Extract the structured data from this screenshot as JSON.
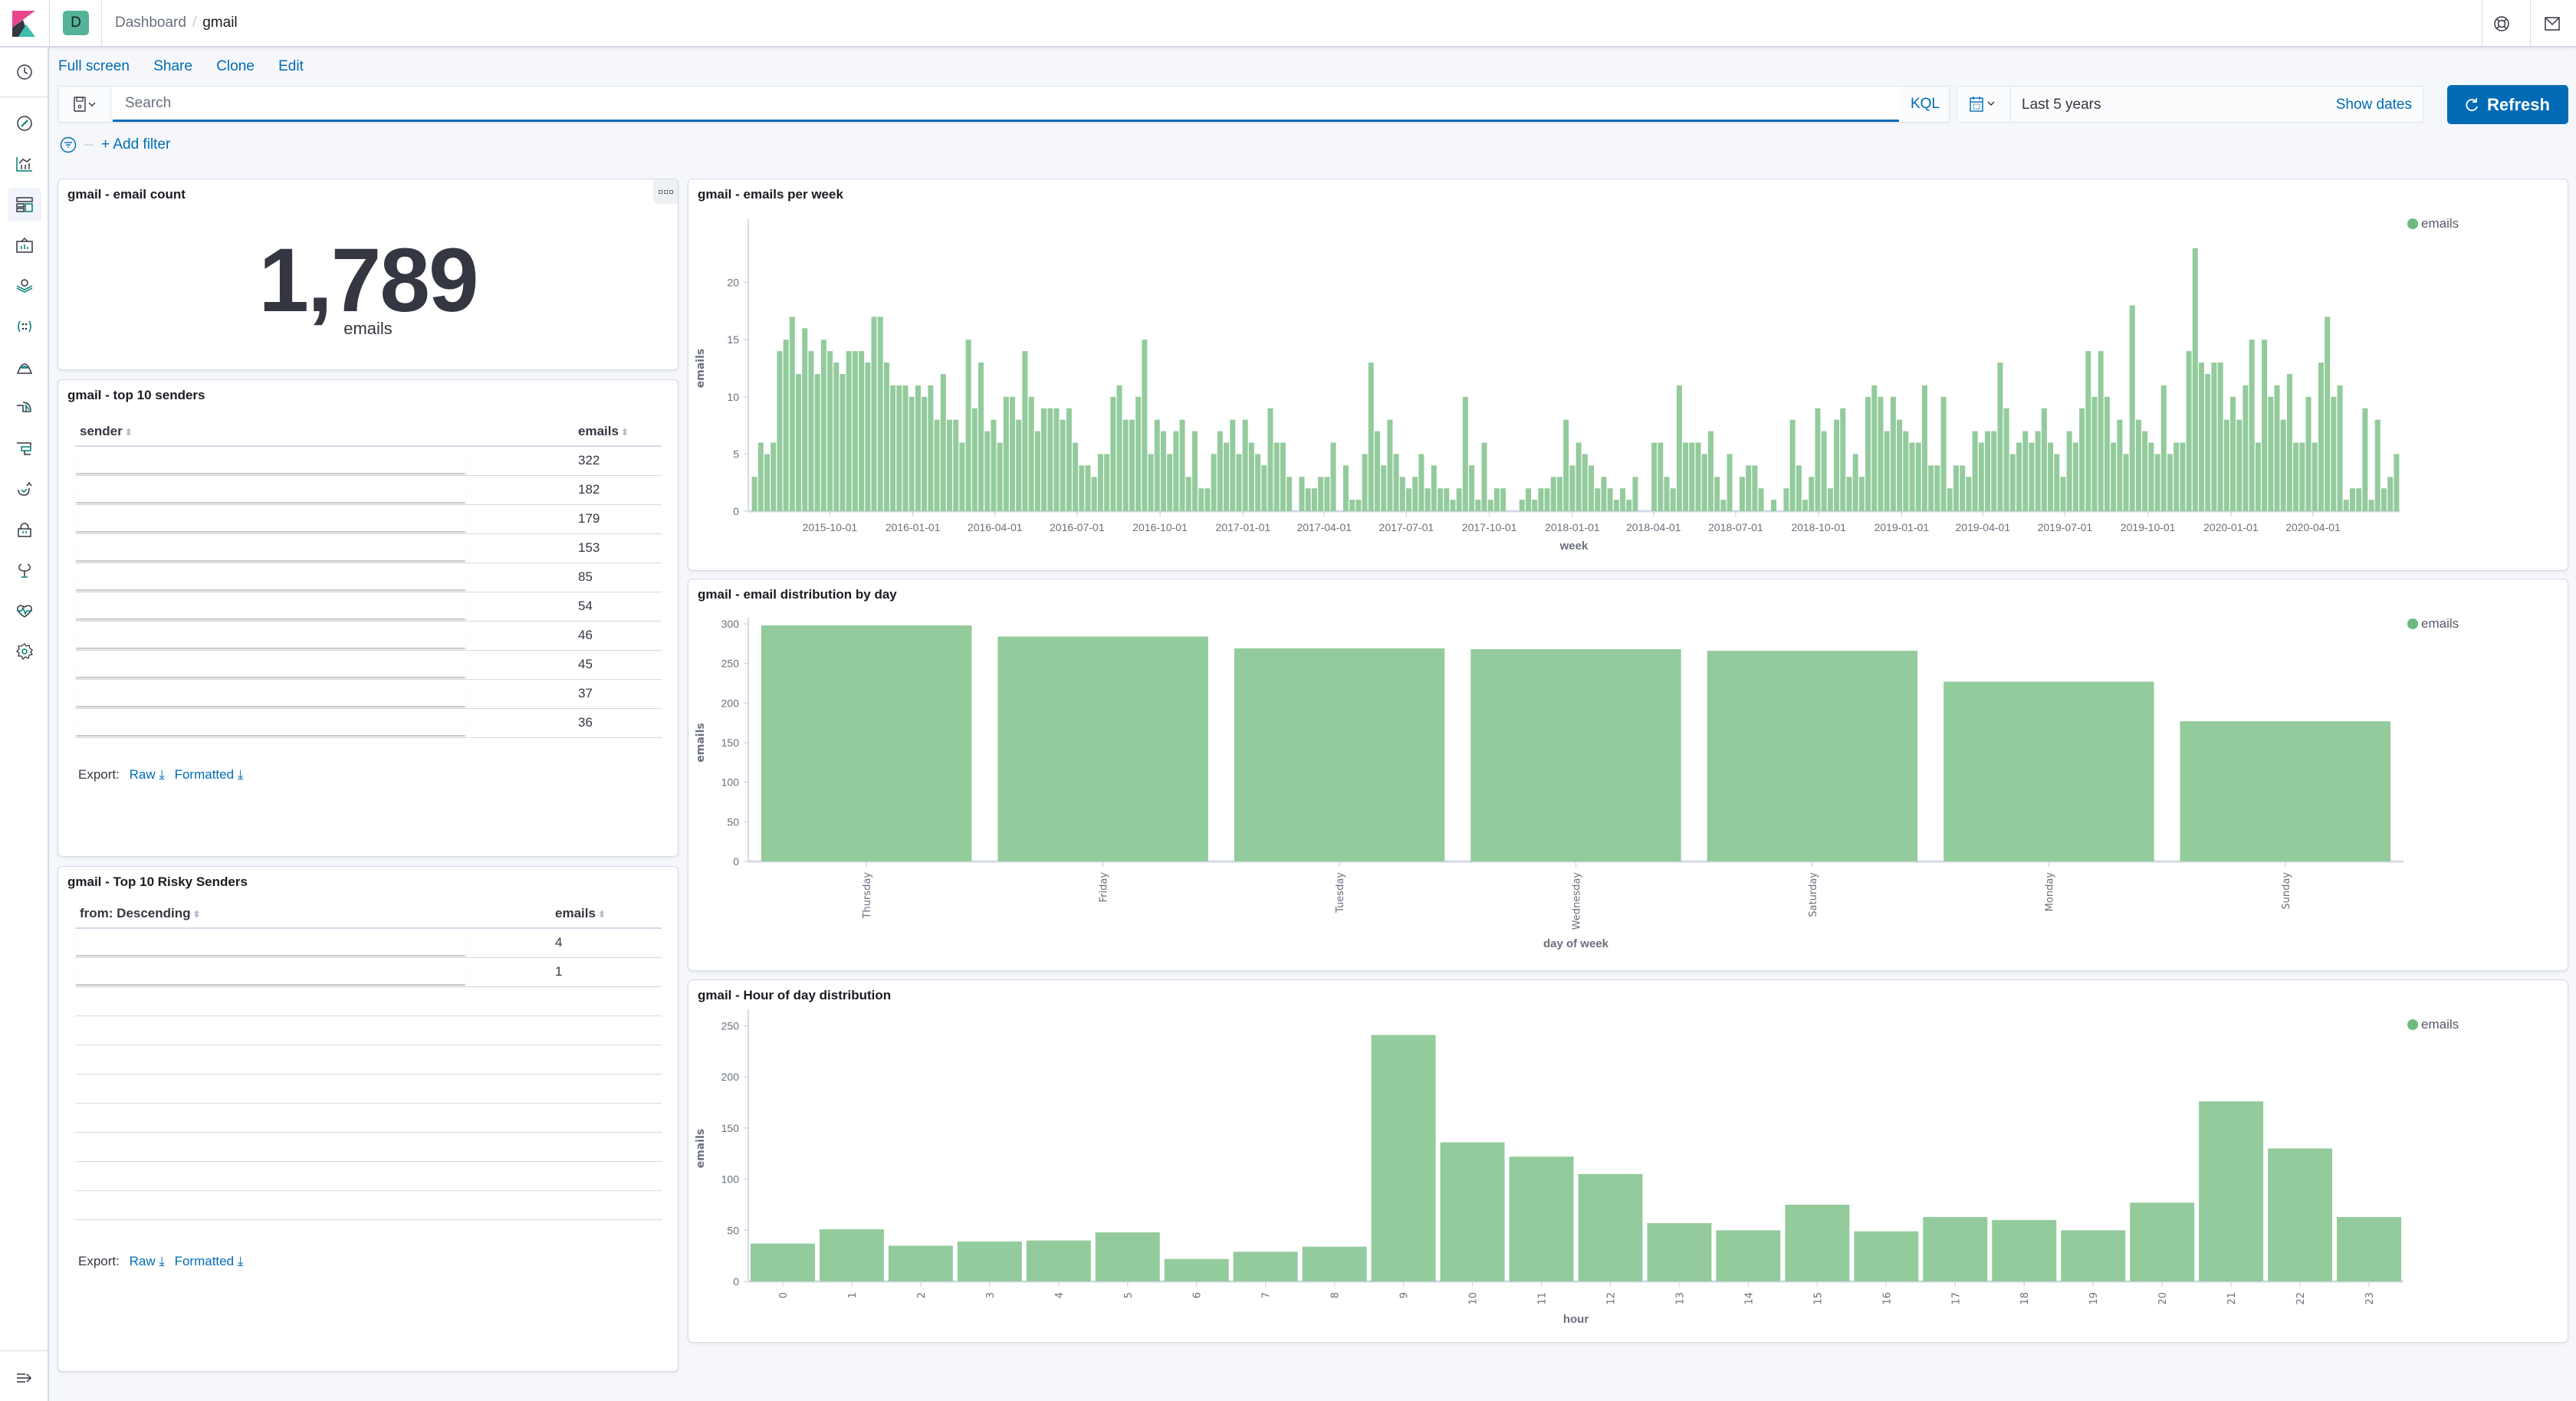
{
  "header": {
    "space_initial": "D",
    "breadcrumbs": [
      "Dashboard",
      "gmail"
    ]
  },
  "sidebar": {
    "items": [
      {
        "name": "recently-viewed",
        "icon": "clock-icon"
      },
      {
        "name": "discover",
        "icon": "compass-icon"
      },
      {
        "name": "visualize",
        "icon": "visualize-icon"
      },
      {
        "name": "dashboard",
        "icon": "dashboard-icon",
        "active": true
      },
      {
        "name": "canvas",
        "icon": "canvas-icon"
      },
      {
        "name": "maps",
        "icon": "maps-icon"
      },
      {
        "name": "machine-learning",
        "icon": "machine-learning-icon"
      },
      {
        "name": "infrastructure",
        "icon": "infrastructure-icon"
      },
      {
        "name": "logs",
        "icon": "logs-icon"
      },
      {
        "name": "apm",
        "icon": "apm-icon"
      },
      {
        "name": "uptime",
        "icon": "uptime-icon"
      },
      {
        "name": "siem",
        "icon": "lock-icon"
      },
      {
        "name": "dev-tools",
        "icon": "wrench-icon"
      },
      {
        "name": "stack-monitoring",
        "icon": "heartbeat-icon"
      },
      {
        "name": "management",
        "icon": "gear-icon"
      }
    ],
    "collapse_icon": "menu-collapse-icon"
  },
  "top_links": [
    "Full screen",
    "Share",
    "Clone",
    "Edit"
  ],
  "query": {
    "placeholder": "Search",
    "value": "",
    "language": "KQL"
  },
  "time": {
    "range": "Last 5 years",
    "show_dates": "Show dates",
    "refresh": "Refresh"
  },
  "filter": {
    "add_filter": "+ Add filter"
  },
  "panels": {
    "count": {
      "title": "gmail - email count",
      "value": "1,789",
      "label": "emails"
    },
    "top_senders": {
      "title": "gmail - top 10 senders",
      "columns": [
        "sender",
        "emails"
      ],
      "rows": [
        {
          "sender": "",
          "emails": "322"
        },
        {
          "sender": "",
          "emails": "182"
        },
        {
          "sender": "",
          "emails": "179"
        },
        {
          "sender": "",
          "emails": "153"
        },
        {
          "sender": "",
          "emails": "85"
        },
        {
          "sender": "",
          "emails": "54"
        },
        {
          "sender": "",
          "emails": "46"
        },
        {
          "sender": "",
          "emails": "45"
        },
        {
          "sender": "",
          "emails": "37"
        },
        {
          "sender": "",
          "emails": "36"
        }
      ],
      "export_label": "Export:",
      "export_raw": "Raw",
      "export_formatted": "Formatted"
    },
    "risky_senders": {
      "title": "gmail - Top 10 Risky Senders",
      "columns": [
        "from: Descending",
        "emails"
      ],
      "rows": [
        {
          "sender": "",
          "emails": "4"
        },
        {
          "sender": "",
          "emails": "1"
        }
      ],
      "export_label": "Export:",
      "export_raw": "Raw",
      "export_formatted": "Formatted"
    }
  },
  "colors": {
    "bar": "#93cb9c",
    "legend": "#6dba7f",
    "accent": "#006bb4"
  },
  "chart_data": [
    {
      "type": "bar",
      "title": "gmail - emails per week",
      "xlabel": "week",
      "ylabel": "emails",
      "ylim": [
        0,
        25
      ],
      "yticks": [
        0,
        5,
        10,
        15,
        20
      ],
      "xticks": [
        "2015-10-01",
        "2016-01-01",
        "2016-04-01",
        "2016-07-01",
        "2016-10-01",
        "2017-01-01",
        "2017-04-01",
        "2017-07-01",
        "2017-10-01",
        "2018-01-01",
        "2018-04-01",
        "2018-07-01",
        "2018-10-01",
        "2019-01-01",
        "2019-04-01",
        "2019-07-01",
        "2019-10-01",
        "2020-01-01",
        "2020-04-01"
      ],
      "x_start": "2015-07-06",
      "x_end": "2020-06-29",
      "legend": [
        "emails"
      ],
      "legend_position": "top-right",
      "series": [
        {
          "name": "emails",
          "values": [
            3,
            6,
            5,
            6,
            14,
            15,
            17,
            12,
            16,
            14,
            12,
            15,
            14,
            13,
            12,
            14,
            14,
            14,
            13,
            17,
            17,
            13,
            11,
            11,
            11,
            10,
            11,
            10,
            11,
            8,
            12,
            8,
            8,
            6,
            15,
            9,
            13,
            7,
            8,
            6,
            10,
            10,
            8,
            14,
            10,
            7,
            9,
            9,
            9,
            8,
            9,
            6,
            4,
            4,
            3,
            5,
            5,
            10,
            11,
            8,
            8,
            10,
            15,
            5,
            8,
            7,
            5,
            7,
            8,
            3,
            7,
            2,
            2,
            5,
            7,
            6,
            8,
            5,
            8,
            6,
            5,
            4,
            9,
            6,
            6,
            3,
            0,
            3,
            2,
            2,
            3,
            3,
            6,
            0,
            4,
            1,
            1,
            5,
            13,
            7,
            4,
            8,
            5,
            3,
            2,
            3,
            5,
            2,
            4,
            2,
            2,
            1,
            2,
            10,
            4,
            1,
            6,
            1,
            2,
            2,
            0,
            0,
            1,
            2,
            1,
            2,
            2,
            3,
            3,
            8,
            4,
            6,
            5,
            4,
            2,
            3,
            2,
            1,
            2,
            1,
            3,
            0,
            0,
            6,
            6,
            3,
            2,
            11,
            6,
            6,
            6,
            5,
            7,
            3,
            1,
            5,
            0,
            3,
            4,
            4,
            2,
            0,
            1,
            0,
            2,
            8,
            4,
            1,
            3,
            9,
            7,
            2,
            8,
            9,
            3,
            5,
            3,
            10,
            11,
            10,
            7,
            10,
            8,
            7,
            6,
            6,
            11,
            4,
            4,
            10,
            2,
            4,
            4,
            3,
            7,
            6,
            7,
            7,
            13,
            9,
            5,
            6,
            7,
            6,
            7,
            9,
            6,
            5,
            3,
            7,
            6,
            9,
            14,
            10,
            14,
            10,
            6,
            8,
            5,
            18,
            8,
            7,
            6,
            5,
            11,
            5,
            6,
            6,
            14,
            23,
            13,
            12,
            13,
            13,
            8,
            10,
            8,
            11,
            15,
            6,
            15,
            10,
            11,
            8,
            12,
            6,
            6,
            10,
            6,
            13,
            17,
            10,
            11,
            1,
            2,
            2,
            9,
            1,
            8,
            2,
            3,
            5
          ]
        }
      ]
    },
    {
      "type": "bar",
      "title": "gmail - email distribution by day",
      "xlabel": "day of week",
      "ylabel": "emails",
      "ylim": [
        0,
        300
      ],
      "yticks": [
        0,
        50,
        100,
        150,
        200,
        250,
        300
      ],
      "categories": [
        "Thursday",
        "Friday",
        "Tuesday",
        "Wednesday",
        "Saturday",
        "Monday",
        "Sunday"
      ],
      "legend": [
        "emails"
      ],
      "legend_position": "top-right",
      "series": [
        {
          "name": "emails",
          "values": [
            298,
            284,
            269,
            268,
            266,
            227,
            177
          ]
        }
      ]
    },
    {
      "type": "bar",
      "title": "gmail - Hour of day distribution",
      "xlabel": "hour",
      "ylabel": "emails",
      "ylim": [
        0,
        260
      ],
      "yticks": [
        0,
        50,
        100,
        150,
        200,
        250
      ],
      "categories": [
        "0",
        "1",
        "2",
        "3",
        "4",
        "5",
        "6",
        "7",
        "8",
        "9",
        "10",
        "11",
        "12",
        "13",
        "14",
        "15",
        "16",
        "17",
        "18",
        "19",
        "20",
        "21",
        "22",
        "23"
      ],
      "legend": [
        "emails"
      ],
      "legend_position": "top-right",
      "series": [
        {
          "name": "emails",
          "values": [
            37,
            51,
            35,
            39,
            40,
            48,
            22,
            29,
            34,
            241,
            136,
            122,
            105,
            57,
            50,
            75,
            49,
            63,
            60,
            50,
            77,
            176,
            130,
            63
          ]
        }
      ]
    }
  ]
}
